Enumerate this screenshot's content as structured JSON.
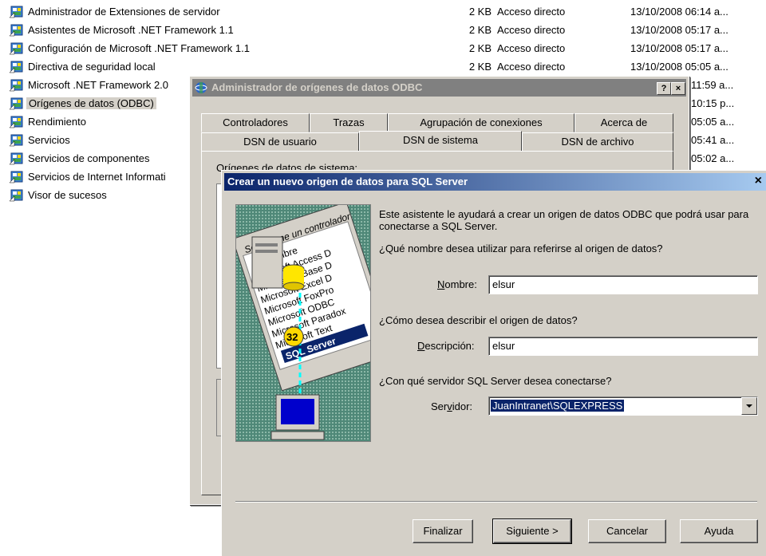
{
  "files": [
    {
      "name": "Administrador de Extensiones de servidor",
      "size": "2 KB",
      "type": "Acceso directo",
      "date": "13/10/2008 06:14 a..."
    },
    {
      "name": "Asistentes de Microsoft .NET Framework 1.1",
      "size": "2 KB",
      "type": "Acceso directo",
      "date": "13/10/2008 05:17 a..."
    },
    {
      "name": "Configuración de Microsoft .NET Framework 1.1",
      "size": "2 KB",
      "type": "Acceso directo",
      "date": "13/10/2008 05:17 a..."
    },
    {
      "name": "Directiva de seguridad local",
      "size": "2 KB",
      "type": "Acceso directo",
      "date": "13/10/2008 05:05 a..."
    },
    {
      "name": "Microsoft .NET Framework 2.0",
      "size": "",
      "type": "",
      "date": "11:59 a..."
    },
    {
      "name": "Orígenes de datos (ODBC)",
      "size": "",
      "type": "",
      "date": "10:15 p..."
    },
    {
      "name": "Rendimiento",
      "size": "",
      "type": "",
      "date": "05:05 a..."
    },
    {
      "name": "Servicios",
      "size": "",
      "type": "",
      "date": "05:41 a..."
    },
    {
      "name": "Servicios de componentes",
      "size": "",
      "type": "",
      "date": "05:02 a..."
    },
    {
      "name": "Servicios de Internet Informati",
      "size": "",
      "type": "",
      "date": ""
    },
    {
      "name": "Visor de sucesos",
      "size": "",
      "type": "",
      "date": ""
    }
  ],
  "odbc": {
    "title": "Administrador de orígenes de datos ODBC",
    "help_btn": "?",
    "close_btn": "×",
    "tabs_top": [
      "Controladores",
      "Trazas",
      "Agrupación de conexiones",
      "Acerca de"
    ],
    "tabs_bottom": [
      "DSN de usuario",
      "DSN de sistema",
      "DSN de archivo"
    ],
    "partial_label": "Orígenes de datos de sistema:"
  },
  "wizard": {
    "title": "Crear un nuevo origen de datos para SQL Server",
    "close_btn": "×",
    "intro": "Este asistente le ayudará a crear un origen de datos ODBC que podrá usar para conectarse a SQL Server.",
    "q_name": "¿Qué nombre desea utilizar para referirse al origen de datos?",
    "name_label": "Nombre:",
    "name_value": "elsur",
    "q_desc": "¿Cómo desea describir el origen de datos?",
    "desc_label": "Descripción:",
    "desc_value": "elsur",
    "q_server": "¿Con qué servidor SQL Server desea conectarse?",
    "server_label": "Servidor:",
    "server_value": "JuanIntranet\\SQLEXPRESS",
    "illustration": {
      "header": "Seleccione un controlador",
      "col": "Nombre",
      "items": [
        "Microsoft Access D",
        "Microsoft dBase D",
        "Microsoft Excel D",
        "Microsoft FoxPro",
        "Microsoft ODBC",
        "Microsoft Paradox",
        "Microsoft Text",
        "SQL Server"
      ],
      "badge": "32"
    },
    "buttons": {
      "finish": "Finalizar",
      "next": "Siguiente >",
      "cancel": "Cancelar",
      "help": "Ayuda"
    }
  }
}
